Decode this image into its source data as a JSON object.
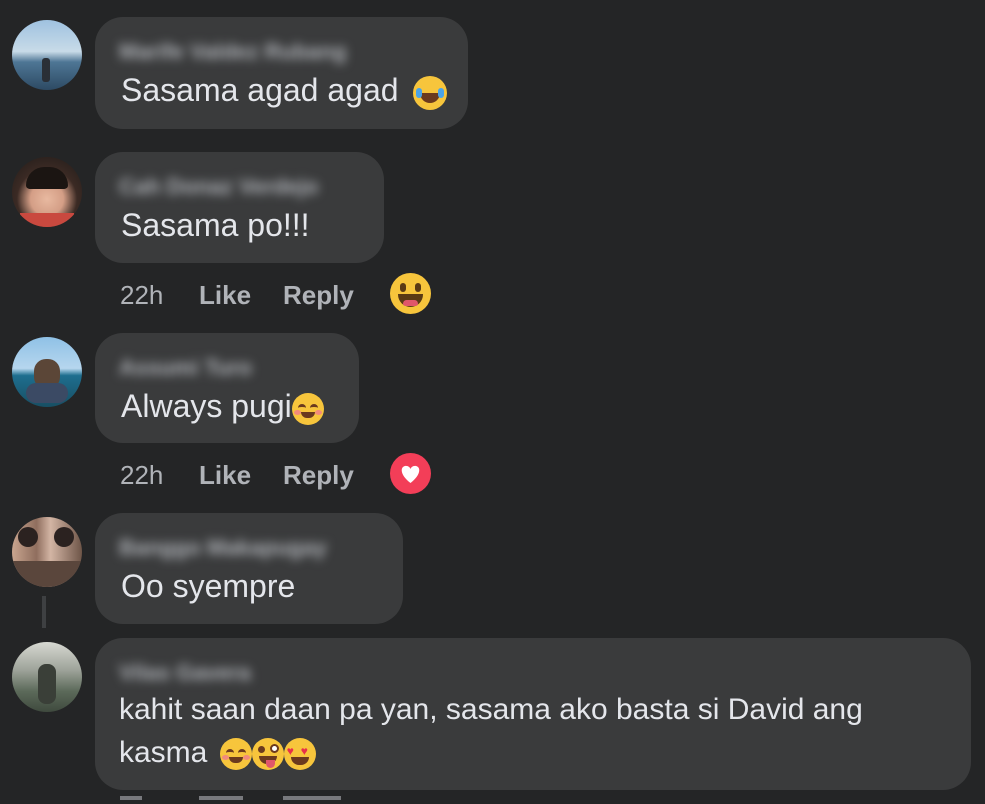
{
  "comments": [
    {
      "author": "Marife Valdez Rubang",
      "text": "Sasama agad agad",
      "emoji": "joy"
    },
    {
      "author": "Cah Donaz Verdejo",
      "text": "Sasama po!!!",
      "time": "22h",
      "like": "Like",
      "reply": "Reply",
      "reaction": "haha"
    },
    {
      "author": "Assumi Turo",
      "text": "Always pugi",
      "emoji": "smirk",
      "time": "22h",
      "like": "Like",
      "reply": "Reply",
      "reaction": "love"
    },
    {
      "author": "Banggo Makapugay",
      "text": "Oo syempre"
    },
    {
      "author": "Vilas Gavera",
      "text": "kahit saan daan pa yan, sasama ako basta si David ang kasma",
      "emojis": [
        "smirk",
        "zany",
        "heart-eyes"
      ]
    }
  ],
  "colors": {
    "background": "#242526",
    "bubble": "#3a3b3c",
    "text": "#e4e6eb",
    "muted": "#b0b3b8",
    "love": "#f33e58",
    "emoji_yellow": "#f7c53c"
  }
}
